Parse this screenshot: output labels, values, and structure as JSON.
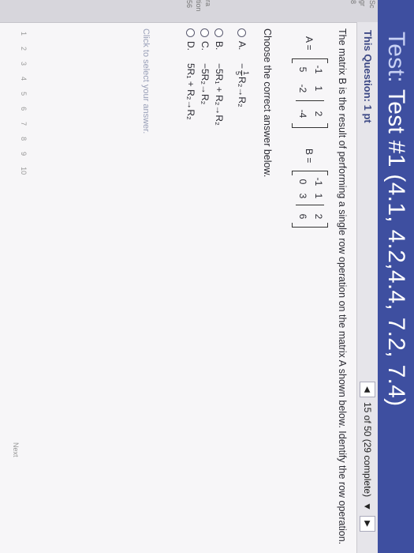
{
  "header": {
    "test_label": "Test:",
    "title": "Test #1 (4.1, 4.2,4.4, 7.2, 7.4)"
  },
  "left_strip": {
    "lines": [
      "Sc",
      "gr",
      "8",
      "ra",
      "tion",
      "56",
      "era",
      "tand",
      "2"
    ]
  },
  "question_bar": {
    "points": "This Question: 1 pt",
    "progress": "15 of 50 (29 complete)"
  },
  "question": {
    "text": "The matrix B is the result of performing a single row operation on the matrix A shown below. Identify the row operation.",
    "matrix_a_label": "A =",
    "matrix_a": [
      [
        "-1",
        "1",
        "2"
      ],
      [
        "5",
        "-2",
        "-4"
      ]
    ],
    "matrix_b_label": "B =",
    "matrix_b": [
      [
        "-1",
        "1",
        "2"
      ],
      [
        "0",
        "3",
        "6"
      ]
    ],
    "choose": "Choose the correct answer below."
  },
  "options": [
    {
      "letter": "A.",
      "sign": "−",
      "frac_num": "1",
      "frac_den": "5",
      "rest": "R₂→R₂"
    },
    {
      "letter": "B.",
      "text": "−5R₁ + R₂→R₂"
    },
    {
      "letter": "C.",
      "text": "−5R₂→R₂"
    },
    {
      "letter": "D.",
      "text": "5R₁ + R₂→R₂"
    }
  ],
  "instruction": "Click to select your answer.",
  "bottom": {
    "numbers": [
      "1",
      "2",
      "3",
      "4",
      "5",
      "6",
      "7",
      "8",
      "9",
      "10"
    ],
    "next_label": "Next"
  }
}
